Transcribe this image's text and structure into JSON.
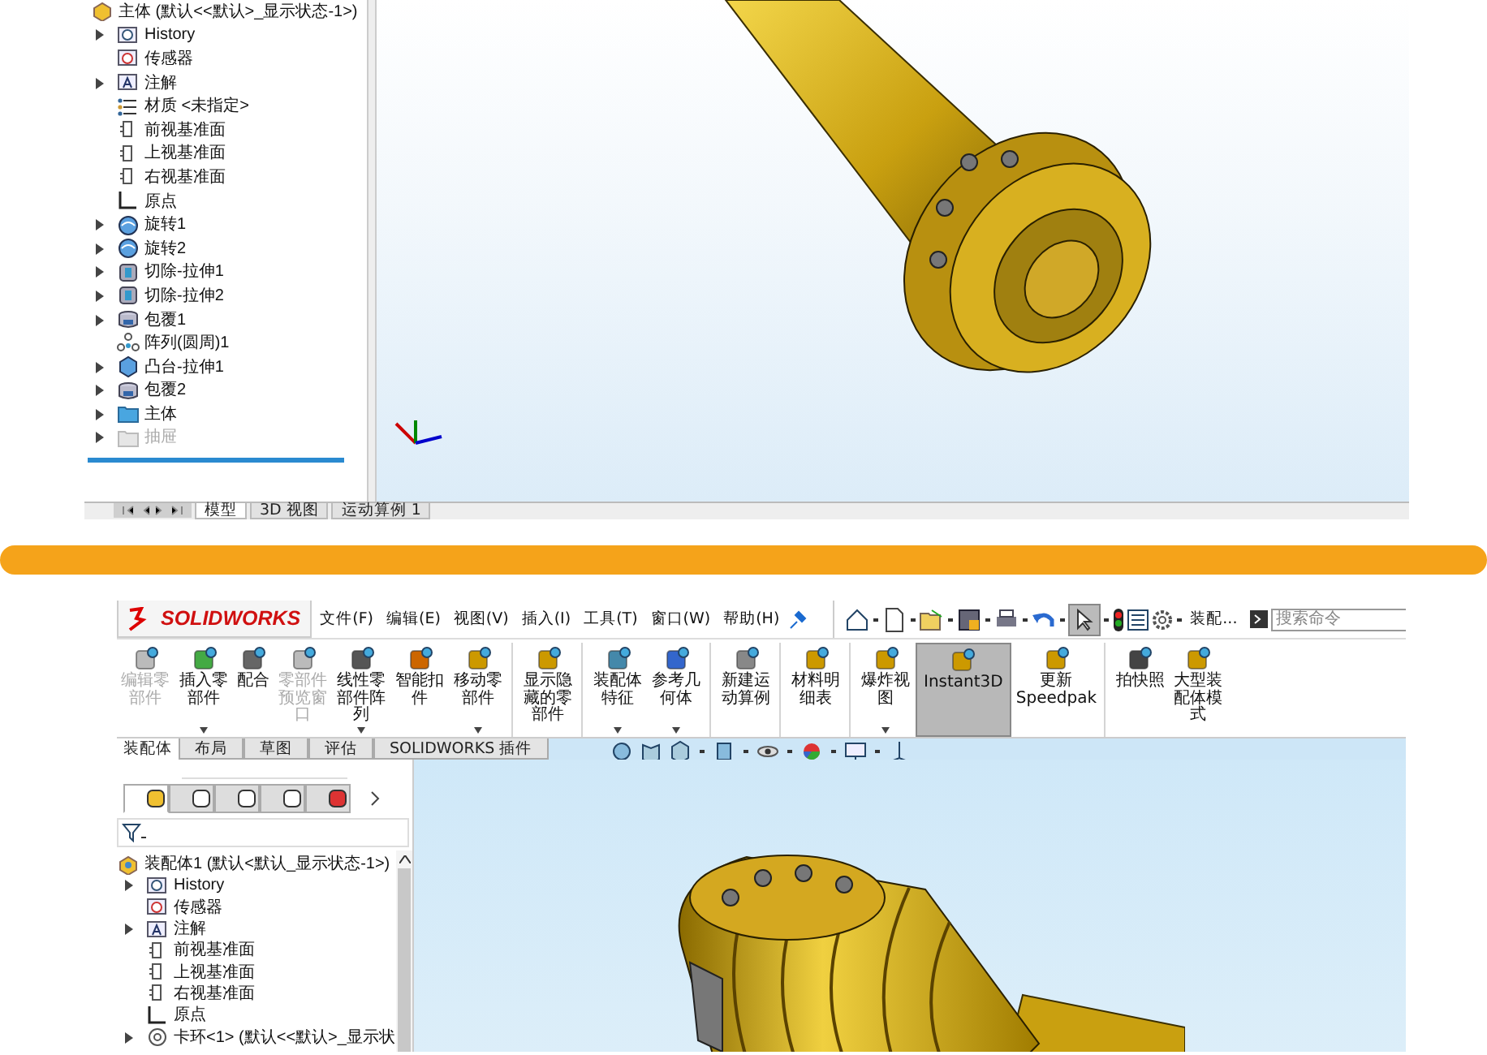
{
  "top_panel": {
    "tree_header": "主体 (默认<<默认>_显示状态-1>)",
    "tree": [
      {
        "label": "History",
        "kind": "history",
        "expandable": true,
        "disabled": false
      },
      {
        "label": "传感器",
        "kind": "sensor",
        "expandable": false,
        "disabled": false
      },
      {
        "label": "注解",
        "kind": "annotation",
        "expandable": true,
        "disabled": false
      },
      {
        "label": "材质 <未指定>",
        "kind": "material",
        "expandable": false,
        "disabled": false
      },
      {
        "label": "前视基准面",
        "kind": "plane",
        "expandable": false,
        "disabled": false
      },
      {
        "label": "上视基准面",
        "kind": "plane",
        "expandable": false,
        "disabled": false
      },
      {
        "label": "右视基准面",
        "kind": "plane",
        "expandable": false,
        "disabled": false
      },
      {
        "label": "原点",
        "kind": "origin",
        "expandable": false,
        "disabled": false
      },
      {
        "label": "旋转1",
        "kind": "revolve",
        "expandable": true,
        "disabled": false
      },
      {
        "label": "旋转2",
        "kind": "revolve",
        "expandable": true,
        "disabled": false
      },
      {
        "label": "切除-拉伸1",
        "kind": "cut",
        "expandable": true,
        "disabled": false
      },
      {
        "label": "切除-拉伸2",
        "kind": "cut",
        "expandable": true,
        "disabled": false
      },
      {
        "label": "包覆1",
        "kind": "wrap",
        "expandable": true,
        "disabled": false
      },
      {
        "label": "阵列(圆周)1",
        "kind": "pattern",
        "expandable": false,
        "disabled": false
      },
      {
        "label": "凸台-拉伸1",
        "kind": "boss",
        "expandable": true,
        "disabled": false
      },
      {
        "label": "包覆2",
        "kind": "wrap",
        "expandable": true,
        "disabled": false
      },
      {
        "label": "主体",
        "kind": "folder",
        "expandable": true,
        "disabled": false
      },
      {
        "label": "抽屉",
        "kind": "folder",
        "expandable": true,
        "disabled": true
      }
    ],
    "bottom_tabs": [
      {
        "label": "模型",
        "selected": true
      },
      {
        "label": "3D 视图",
        "selected": false
      },
      {
        "label": "运动算例 1",
        "selected": false
      }
    ]
  },
  "bottom_panel": {
    "logo_text": "SOLIDWORKS",
    "menus": [
      "文件(F)",
      "编辑(E)",
      "视图(V)",
      "插入(I)",
      "工具(T)",
      "窗口(W)",
      "帮助(H)"
    ],
    "quick_label": "装配...",
    "search": {
      "placeholder": "搜索命令"
    },
    "ribbon": [
      {
        "label": "编辑零部件",
        "kind": "edit",
        "disabled": true,
        "dropdown": false,
        "selected": false,
        "group_end": false
      },
      {
        "label": "插入零部件",
        "kind": "insert",
        "disabled": false,
        "dropdown": true,
        "selected": false,
        "group_end": false
      },
      {
        "label": "配合",
        "kind": "mate",
        "disabled": false,
        "dropdown": false,
        "selected": false,
        "group_end": false
      },
      {
        "label": "零部件预览窗口",
        "kind": "preview",
        "disabled": true,
        "dropdown": false,
        "selected": false,
        "group_end": false
      },
      {
        "label": "线性零部件阵列",
        "kind": "pattern",
        "disabled": false,
        "dropdown": true,
        "selected": false,
        "group_end": false
      },
      {
        "label": "智能扣件",
        "kind": "fastener",
        "disabled": false,
        "dropdown": false,
        "selected": false,
        "group_end": false
      },
      {
        "label": "移动零部件",
        "kind": "move",
        "disabled": false,
        "dropdown": true,
        "selected": false,
        "group_end": true
      },
      {
        "label": "显示隐藏的零部件",
        "kind": "show",
        "disabled": false,
        "dropdown": false,
        "selected": false,
        "group_end": true
      },
      {
        "label": "装配体特征",
        "kind": "feature",
        "disabled": false,
        "dropdown": true,
        "selected": false,
        "group_end": false
      },
      {
        "label": "参考几何体",
        "kind": "geometry",
        "disabled": false,
        "dropdown": true,
        "selected": false,
        "group_end": true
      },
      {
        "label": "新建运动算例",
        "kind": "motion",
        "disabled": false,
        "dropdown": false,
        "selected": false,
        "group_end": true
      },
      {
        "label": "材料明细表",
        "kind": "bom",
        "disabled": false,
        "dropdown": false,
        "selected": false,
        "group_end": true
      },
      {
        "label": "爆炸视图",
        "kind": "explode",
        "disabled": false,
        "dropdown": true,
        "selected": false,
        "group_end": false
      },
      {
        "label": "Instant3D",
        "kind": "instant3d",
        "disabled": false,
        "dropdown": false,
        "selected": true,
        "group_end": false
      },
      {
        "label": "更新 Speedpak",
        "kind": "speedpak",
        "disabled": false,
        "dropdown": false,
        "selected": false,
        "group_end": true
      },
      {
        "label": "拍快照",
        "kind": "snapshot",
        "disabled": false,
        "dropdown": false,
        "selected": false,
        "group_end": false
      },
      {
        "label": "大型装配体模式",
        "kind": "large",
        "disabled": false,
        "dropdown": false,
        "selected": false,
        "group_end": false
      }
    ],
    "ribbon_tabs": [
      {
        "label": "装配体",
        "selected": true
      },
      {
        "label": "布局",
        "selected": false
      },
      {
        "label": "草图",
        "selected": false
      },
      {
        "label": "评估",
        "selected": false
      },
      {
        "label": "SOLIDWORKS 插件",
        "selected": false
      }
    ],
    "panel_tabs": [
      {
        "kind": "feature-tree",
        "selected": true
      },
      {
        "kind": "property",
        "selected": false
      },
      {
        "kind": "config",
        "selected": false
      },
      {
        "kind": "dimxpert",
        "selected": false
      },
      {
        "kind": "display",
        "selected": false
      }
    ],
    "tree_header": "装配体1 (默认<默认_显示状态-1>)",
    "tree": [
      {
        "label": "History",
        "kind": "history",
        "expandable": true
      },
      {
        "label": "传感器",
        "kind": "sensor",
        "expandable": false
      },
      {
        "label": "注解",
        "kind": "annotation",
        "expandable": true
      },
      {
        "label": "前视基准面",
        "kind": "plane",
        "expandable": false
      },
      {
        "label": "上视基准面",
        "kind": "plane",
        "expandable": false
      },
      {
        "label": "右视基准面",
        "kind": "plane",
        "expandable": false
      },
      {
        "label": "原点",
        "kind": "origin",
        "expandable": false
      },
      {
        "label": "卡环<1> (默认<<默认>_显示状",
        "kind": "part",
        "expandable": true
      }
    ]
  }
}
